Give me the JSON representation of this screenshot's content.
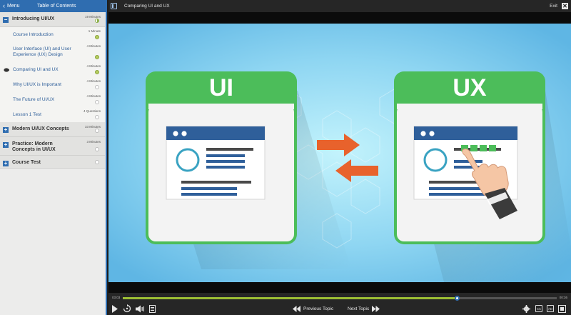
{
  "sidebar": {
    "menu_label": "Menu",
    "title": "Table of Contents",
    "sections": [
      {
        "title": "Introducing UI/UX",
        "expand_symbol": "−",
        "duration": "19 Minutes",
        "lessons": [
          {
            "title": "Course Introduction",
            "duration": "1 Minute",
            "status": "complete"
          },
          {
            "title": "User Interface (UI) and User Experience (UX) Design",
            "duration": "4 Minutes",
            "status": "complete"
          },
          {
            "title": "Comparing UI and UX",
            "duration": "4 Minutes",
            "status": "complete",
            "current": true
          },
          {
            "title": "Why UI/UX is Important",
            "duration": "4 Minutes",
            "status": "incomplete"
          },
          {
            "title": "The Future of UI/UX",
            "duration": "4 Minutes",
            "status": "incomplete"
          },
          {
            "title": "Lesson 1 Test",
            "duration": "4 Questions",
            "status": "incomplete"
          }
        ]
      },
      {
        "title": "Modern UI/UX Concepts",
        "expand_symbol": "+",
        "duration": "33 Minutes"
      },
      {
        "title": "Practice: Modern Concepts in UI/UX",
        "expand_symbol": "+",
        "duration": "3 Minutes"
      },
      {
        "title": "Course Test",
        "expand_symbol": "+",
        "duration": ""
      }
    ]
  },
  "topbar": {
    "title": "Comparing UI and UX",
    "exit_label": "Exit",
    "close_symbol": "✕"
  },
  "slide": {
    "card_left_label": "UI",
    "card_right_label": "UX"
  },
  "player": {
    "current_time": "03:03",
    "total_time": "00:36",
    "progress": 0.77,
    "prev_label": "Previous Topic",
    "next_label": "Next Topic",
    "cc_label": "CC",
    "ad_label": "AD"
  },
  "colors": {
    "accent": "#2f6db0",
    "progress": "#9cbf34",
    "card_green": "#4cbd5a",
    "arrow_orange": "#e8622c"
  }
}
